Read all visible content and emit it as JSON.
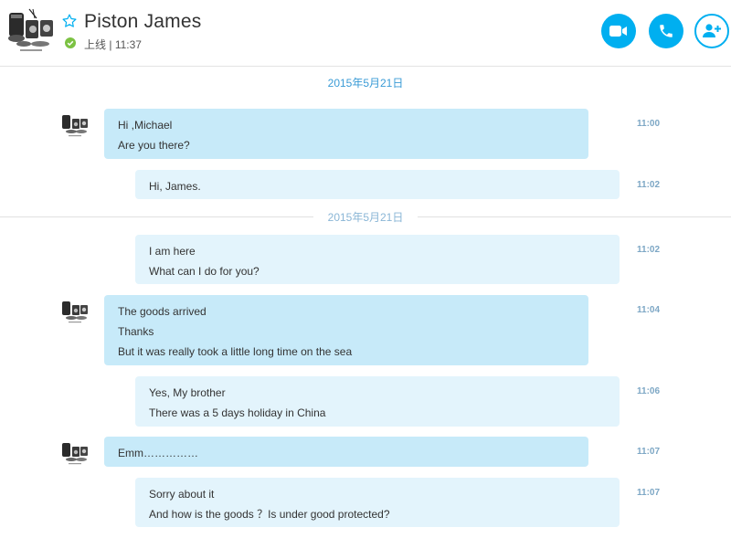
{
  "header": {
    "contact_name": "Piston James",
    "status_label": "上线",
    "status_separator": "|",
    "status_time": "11:37"
  },
  "date_dividers": [
    "2015年5月21日",
    "2015年5月21日"
  ],
  "messages": [
    {
      "from": "in",
      "lines": [
        "Hi ,Michael",
        "Are you there?"
      ],
      "time": "11:00"
    },
    {
      "from": "out",
      "lines": [
        "Hi, James."
      ],
      "time": "11:02"
    },
    {
      "from": "out",
      "lines": [
        "I am here",
        "What can I do for you?"
      ],
      "time": "11:02"
    },
    {
      "from": "in",
      "lines": [
        "The goods arrived",
        "Thanks",
        "But it was really took a little long time on the sea"
      ],
      "time": "11:04"
    },
    {
      "from": "out",
      "lines": [
        "Yes, My brother",
        "There was a 5 days holiday in China"
      ],
      "time": "11:06"
    },
    {
      "from": "in",
      "lines": [
        "Emm……………"
      ],
      "time": "11:07"
    },
    {
      "from": "out",
      "lines": [
        "Sorry about it",
        "And how is the goods ？Is under good protected?"
      ],
      "time": "11:07"
    }
  ],
  "colors": {
    "accent": "#00aff0",
    "bubble_in": "#c7eaf9",
    "bubble_out": "#e3f4fc",
    "date_text": "#3a9bd6",
    "status_online": "#7cc243"
  },
  "icons": [
    "avatar-icon",
    "star-icon",
    "status-online-icon",
    "video-camera-icon",
    "phone-icon",
    "add-contact-icon"
  ]
}
